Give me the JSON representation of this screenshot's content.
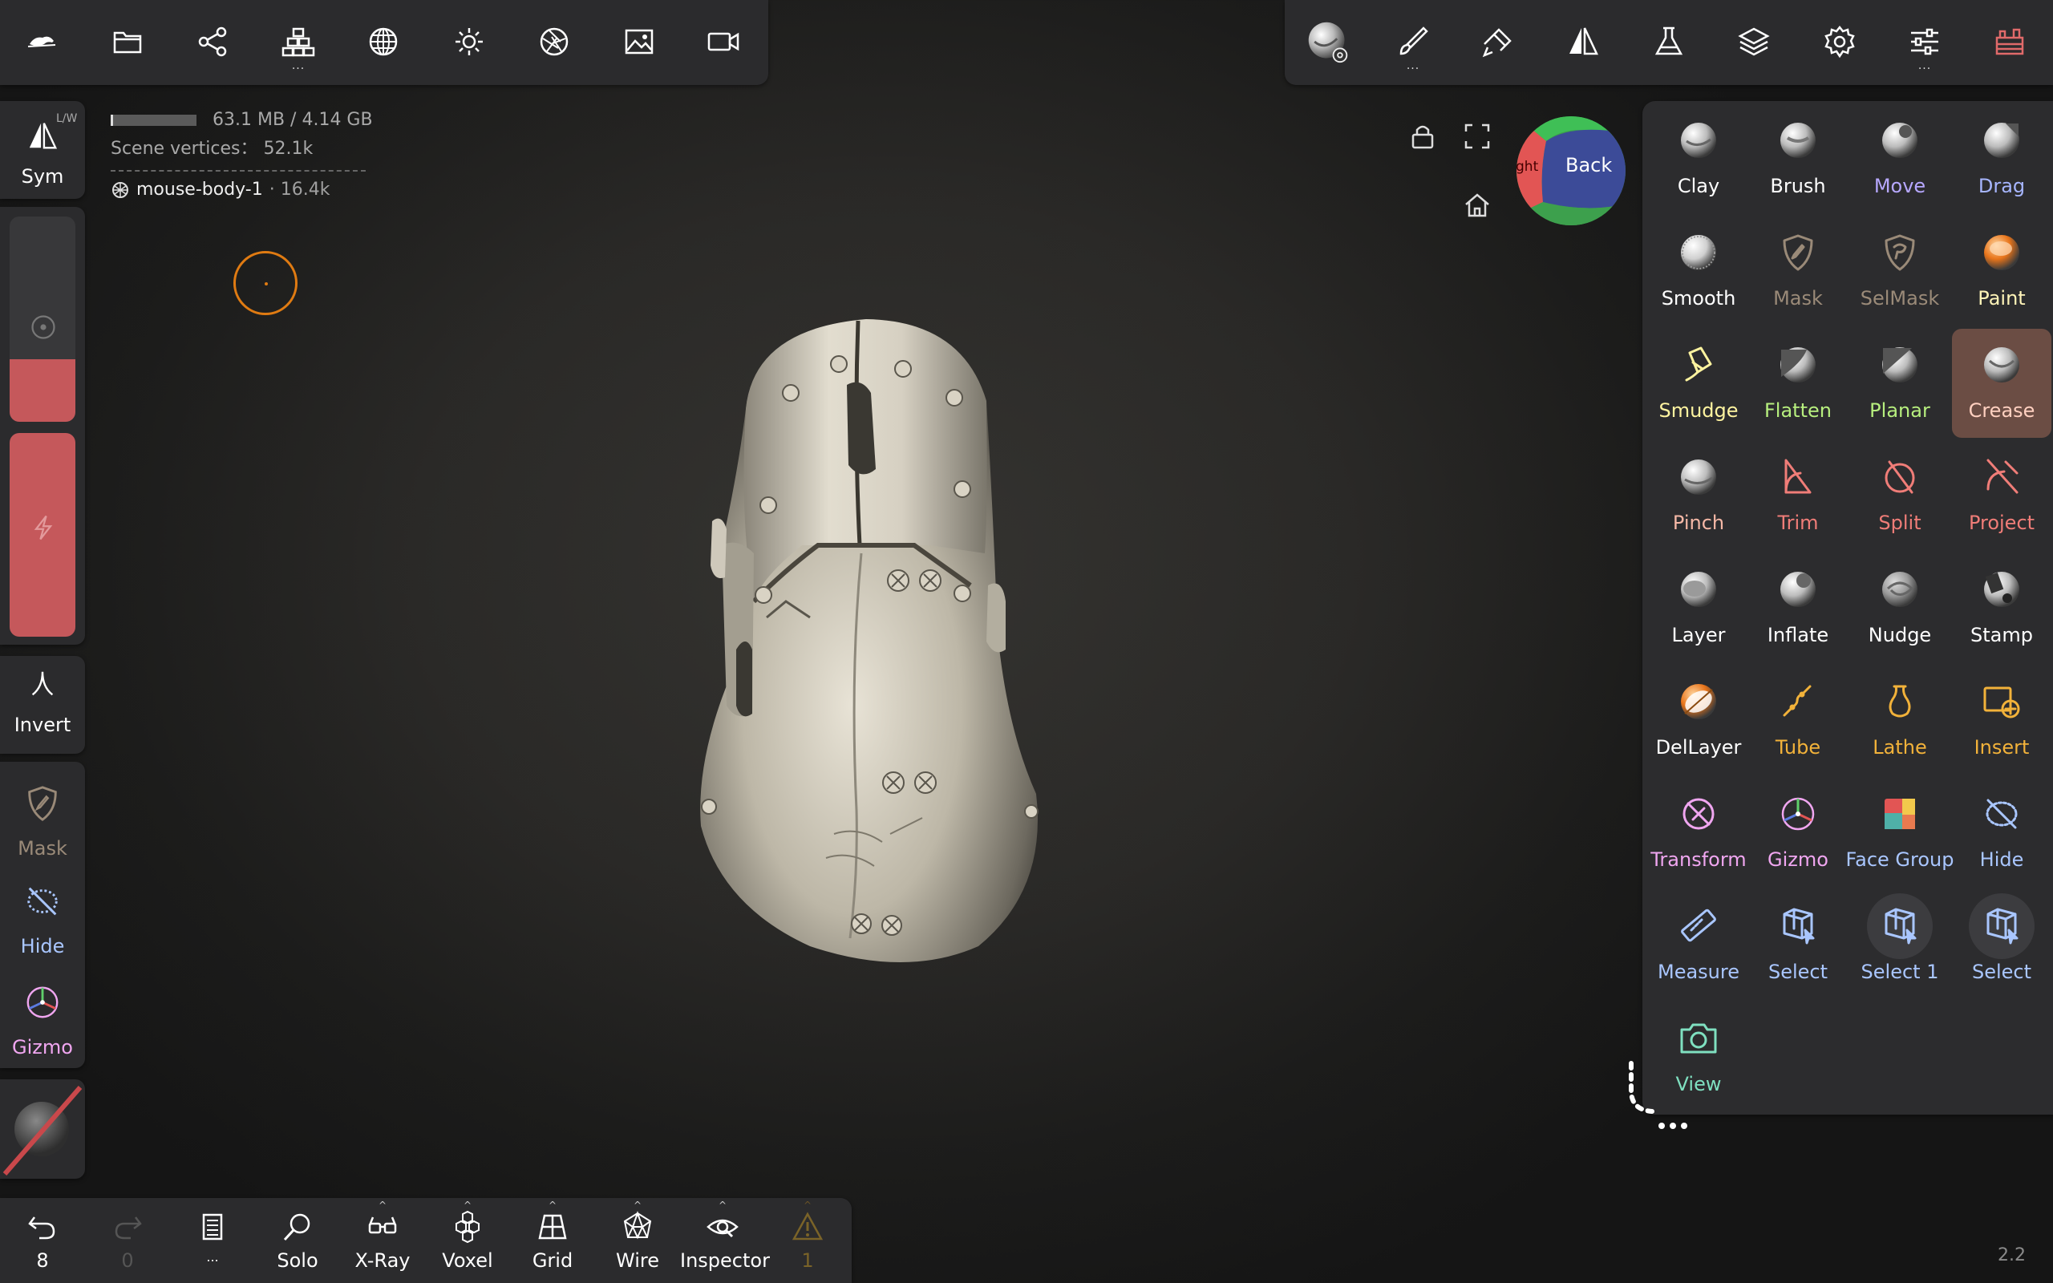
{
  "top_left_toolbar": {
    "icons": [
      "logo-icon",
      "folder-icon",
      "share-icon",
      "scene-tree-icon",
      "mesh-sphere-icon",
      "light-icon",
      "aperture-icon",
      "image-icon",
      "video-icon"
    ]
  },
  "top_right_toolbar": {
    "icons": [
      "material-sphere-icon",
      "brush-icon",
      "paint-tool-icon",
      "symmetry-icon",
      "flask-icon",
      "layers-icon",
      "settings-icon",
      "sliders-icon",
      "store-icon"
    ]
  },
  "stats": {
    "memory": "63.1 MB / 4.14 GB",
    "vertices": "Scene vertices： 52.1k",
    "mesh_name": "mouse-body-1",
    "mesh_count": "· 16.4k"
  },
  "view_cube": {
    "front_label": "Back",
    "side_label": "ght"
  },
  "left_panel": {
    "sym_label": "Sym",
    "sym_corner": "L/W",
    "invert_label": "Invert",
    "mask_label": "Mask",
    "hide_label": "Hide",
    "gizmo_label": "Gizmo"
  },
  "tools": [
    {
      "label": "Clay",
      "color": "#ffffff",
      "icon": "clay-sphere-icon"
    },
    {
      "label": "Brush",
      "color": "#ffffff",
      "icon": "brush-sphere-icon"
    },
    {
      "label": "Move",
      "color": "#b7a8ff",
      "icon": "move-sphere-icon"
    },
    {
      "label": "Drag",
      "color": "#a7b6ff",
      "icon": "drag-sphere-icon"
    },
    {
      "label": "Smooth",
      "color": "#ffffff",
      "icon": "smooth-sphere-icon"
    },
    {
      "label": "Mask",
      "color": "#9a8a78",
      "icon": "mask-shield-icon"
    },
    {
      "label": "SelMask",
      "color": "#9a8a78",
      "icon": "selmask-shield-icon"
    },
    {
      "label": "Paint",
      "color": "#fff4b8",
      "icon": "paint-sphere-icon"
    },
    {
      "label": "Smudge",
      "color": "#fff4a0",
      "icon": "smudge-icon"
    },
    {
      "label": "Flatten",
      "color": "#b7ef7e",
      "icon": "flatten-sphere-icon"
    },
    {
      "label": "Planar",
      "color": "#b7ef7e",
      "icon": "planar-sphere-icon"
    },
    {
      "label": "Crease",
      "color": "#ffd0c0",
      "icon": "crease-sphere-icon"
    },
    {
      "label": "Pinch",
      "color": "#f5b8a6",
      "icon": "pinch-sphere-icon"
    },
    {
      "label": "Trim",
      "color": "#f07d78",
      "icon": "trim-icon"
    },
    {
      "label": "Split",
      "color": "#f07d78",
      "icon": "split-icon"
    },
    {
      "label": "Project",
      "color": "#f07d78",
      "icon": "project-icon"
    },
    {
      "label": "Layer",
      "color": "#ffffff",
      "icon": "layer-sphere-icon"
    },
    {
      "label": "Inflate",
      "color": "#ffffff",
      "icon": "inflate-sphere-icon"
    },
    {
      "label": "Nudge",
      "color": "#ffffff",
      "icon": "nudge-sphere-icon"
    },
    {
      "label": "Stamp",
      "color": "#ffffff",
      "icon": "stamp-sphere-icon"
    },
    {
      "label": "DelLayer",
      "color": "#ffffff",
      "icon": "dellayer-icon"
    },
    {
      "label": "Tube",
      "color": "#f2b23a",
      "icon": "tube-icon"
    },
    {
      "label": "Lathe",
      "color": "#f2b23a",
      "icon": "lathe-icon"
    },
    {
      "label": "Insert",
      "color": "#f2b23a",
      "icon": "insert-icon"
    },
    {
      "label": "Transform",
      "color": "#f0a6f0",
      "icon": "transform-icon"
    },
    {
      "label": "Gizmo",
      "color": "#f0a6f0",
      "icon": "gizmo-icon"
    },
    {
      "label": "Face Group",
      "color": "#a9c6ff",
      "icon": "face-group-icon"
    },
    {
      "label": "Hide",
      "color": "#a9c6ff",
      "icon": "hide-icon"
    },
    {
      "label": "Measure",
      "color": "#a9c6ff",
      "icon": "measure-icon"
    },
    {
      "label": "Select",
      "color": "#a9c6ff",
      "icon": "select-box-icon"
    },
    {
      "label": "Select 1",
      "color": "#a9c6ff",
      "icon": "select-box-icon"
    },
    {
      "label": "Select",
      "color": "#a9c6ff",
      "icon": "select-box-icon"
    },
    {
      "label": "View",
      "color": "#7fe0c0",
      "icon": "camera-icon"
    }
  ],
  "active_tool": "Crease",
  "bottom_bar": {
    "undo_count": "8",
    "redo_count": "0",
    "docs_label": "...",
    "solo_label": "Solo",
    "xray_label": "X-Ray",
    "voxel_label": "Voxel",
    "grid_label": "Grid",
    "wire_label": "Wire",
    "inspector_label": "Inspector",
    "warning_count": "1"
  },
  "version": "2.2"
}
